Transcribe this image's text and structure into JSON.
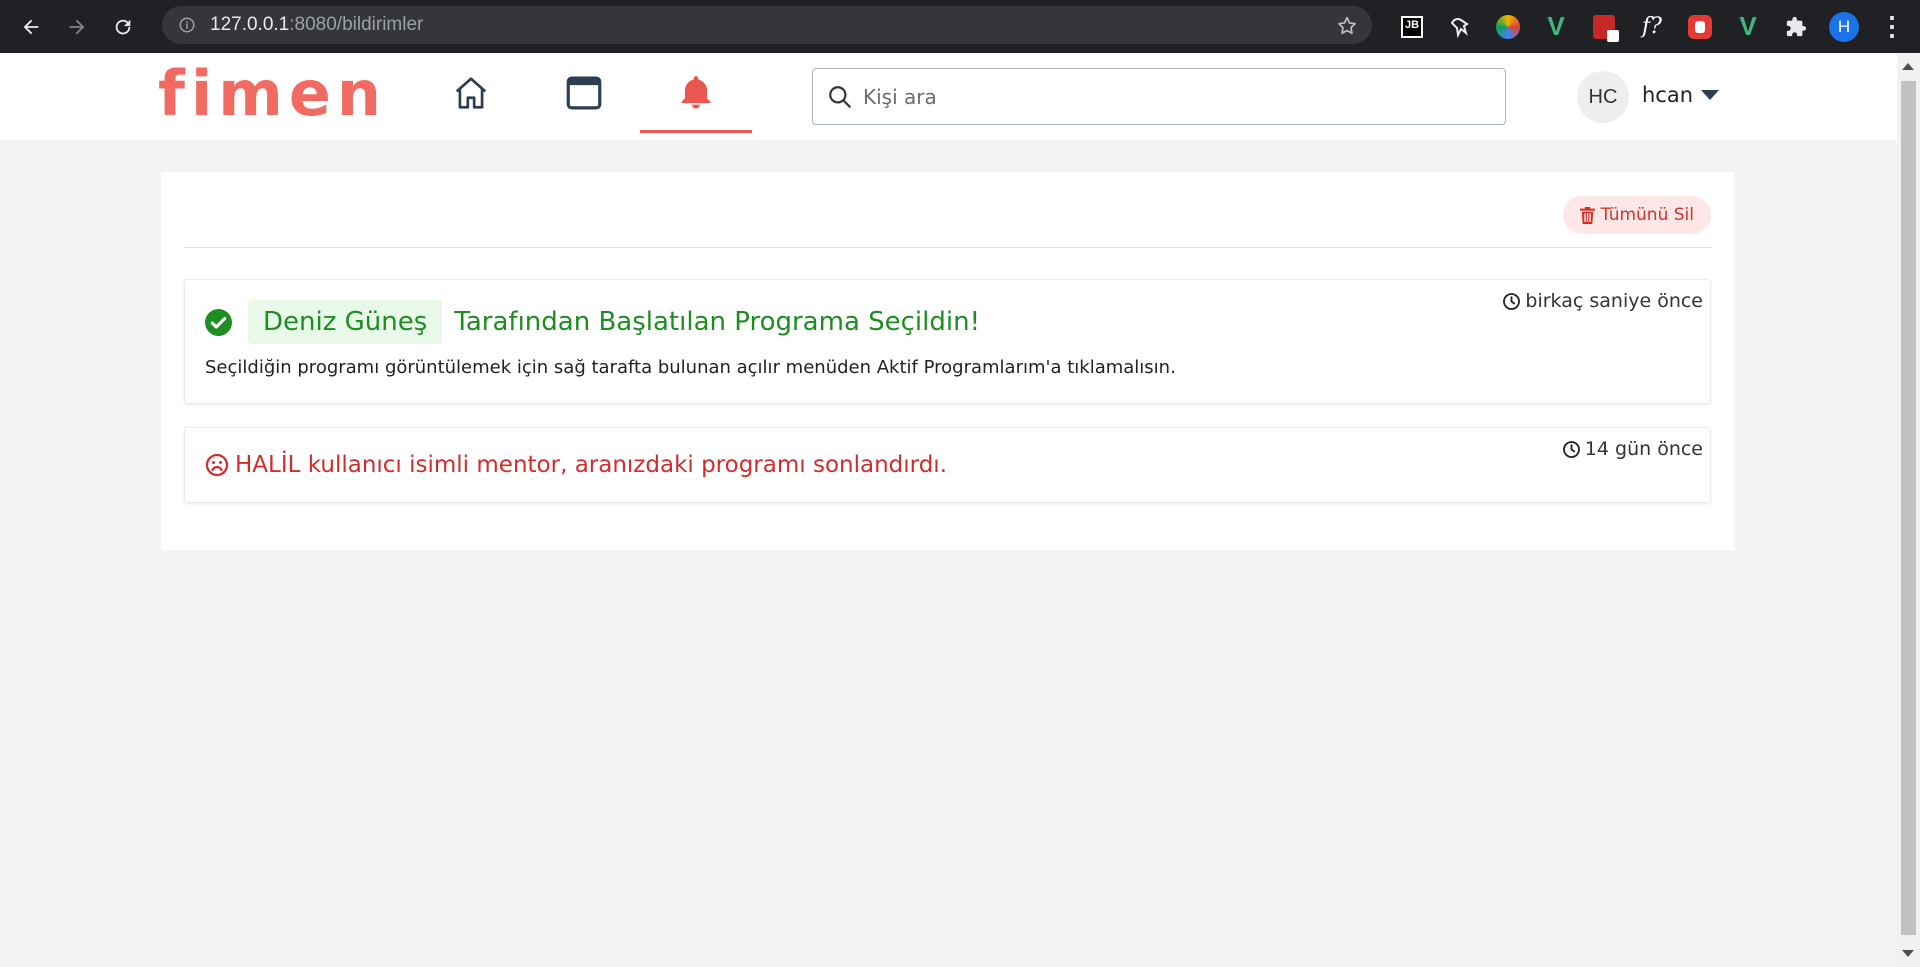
{
  "browser": {
    "url_host": "127.0.0.1",
    "url_path": ":8080/bildirimler",
    "profile_initial": "H",
    "extensions": [
      "jetbrains-icon",
      "cowboy-hat-icon",
      "color-circle-icon",
      "vue-devtools-icon",
      "pdf-icon",
      "font-finder-icon",
      "adblock-icon",
      "vue-icon",
      "puzzle-icon"
    ]
  },
  "header": {
    "logo": "fimen",
    "nav": [
      "home-icon",
      "window-icon",
      "bell-icon"
    ],
    "search_placeholder": "Kişi ara",
    "avatar_initials": "HC",
    "username": "hcan"
  },
  "notifications": {
    "delete_all": "Tümünü Sil",
    "items": [
      {
        "time": "birkaç saniye önce",
        "name": "Deniz Güneş",
        "title": "Tarafından Başlatılan Programa Seçildin!",
        "description": "Seçildiğin programı görüntülemek için sağ tarafta bulunan açılır menüden Aktif Programlarım'a tıklamalısın."
      },
      {
        "time": "14 gün önce",
        "title": "HALİL kullanıcı isimli mentor, aranızdaki programı sonlandırdı."
      }
    ]
  },
  "colors": {
    "brand": "#f26b62",
    "success": "#1e8e22",
    "danger": "#d22d2d"
  }
}
